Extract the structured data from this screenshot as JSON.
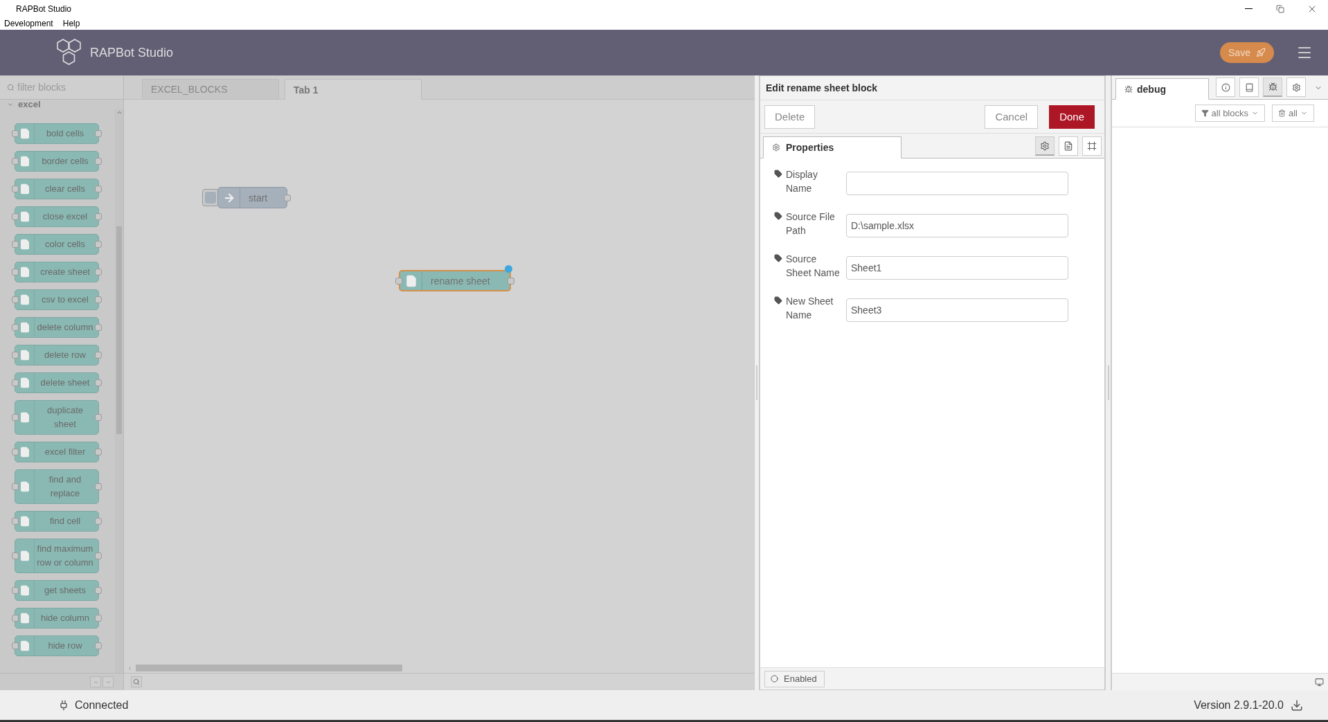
{
  "window": {
    "title": "RAPBot Studio",
    "menu": [
      "Development",
      "Help"
    ]
  },
  "header": {
    "brand": "RAPBot Studio",
    "save": "Save"
  },
  "palette": {
    "placeholder": "filter blocks",
    "category": "excel",
    "blocks": [
      "bold cells",
      "border cells",
      "clear cells",
      "close excel",
      "color cells",
      "create sheet",
      "csv to excel",
      "delete column",
      "delete row",
      "delete sheet",
      "duplicate sheet",
      "excel filter",
      "find and replace",
      "find cell",
      "find maximum row or column",
      "get sheets",
      "hide column",
      "hide row"
    ]
  },
  "workspace": {
    "tabs": [
      {
        "label": "EXCEL_BLOCKS",
        "selected": false
      },
      {
        "label": "Tab 1",
        "selected": true
      }
    ],
    "nodes": [
      {
        "label": "start",
        "kind": "inject",
        "selected": false,
        "changed": false
      },
      {
        "label": "rename sheet",
        "kind": "file",
        "selected": true,
        "changed": true
      }
    ]
  },
  "editor": {
    "title": "Edit rename sheet block",
    "delete": "Delete",
    "cancel": "Cancel",
    "done": "Done",
    "tab": "Properties",
    "icon_tabs": [
      {
        "selected": true
      },
      {
        "selected": false
      },
      {
        "selected": false
      }
    ],
    "fields": [
      {
        "label": "Display Name"
      },
      {
        "label": "Source File Path",
        "value": "D:\\sample.xlsx"
      },
      {
        "label": "Source Sheet Name",
        "value": "Sheet1"
      },
      {
        "label": "New Sheet Name",
        "value": "Sheet3"
      }
    ],
    "enabled": "Enabled"
  },
  "sidebar": {
    "tab": "debug",
    "icon_tabs": [
      {
        "selected": false
      },
      {
        "selected": false
      },
      {
        "selected": true
      },
      {
        "selected": false
      }
    ],
    "filter": "all blocks",
    "clear": "all"
  },
  "status_bar": {
    "connection": "Connected",
    "version": "Version 2.9.1-20.0"
  }
}
